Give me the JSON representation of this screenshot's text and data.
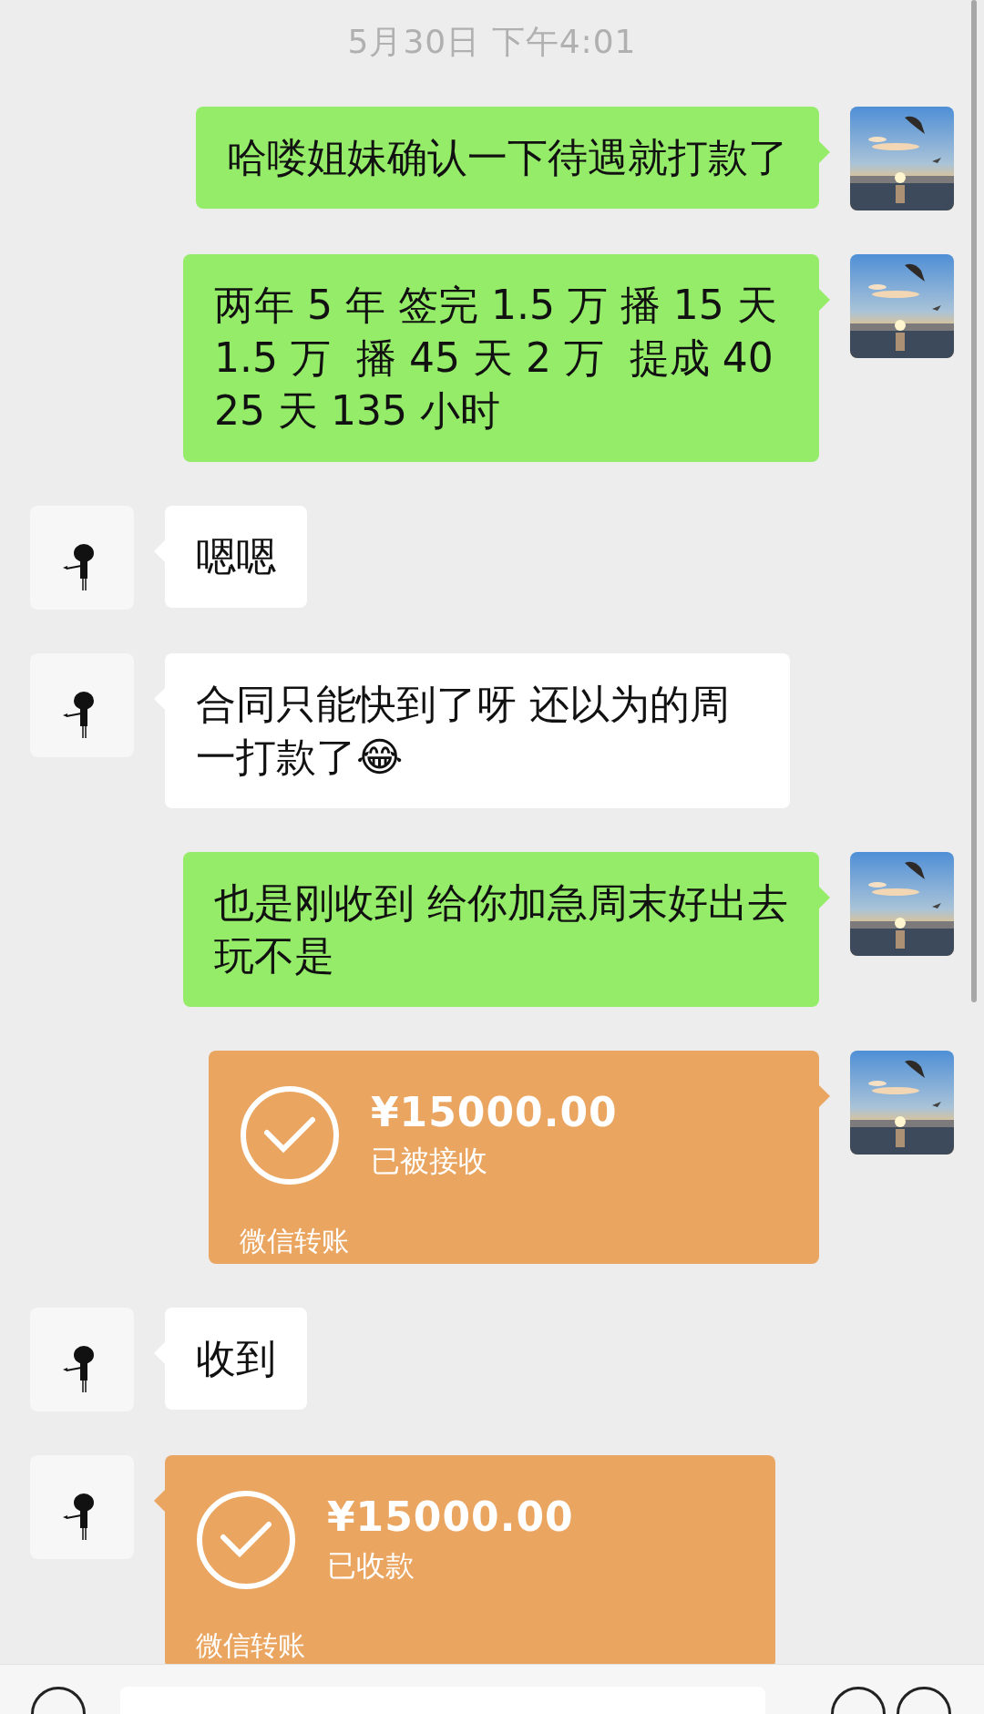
{
  "timestamp": "5月30日 下午4:01",
  "messages": [
    {
      "kind": "text",
      "outgoing": true,
      "text": "哈喽姐妹确认一下待遇就打款了"
    },
    {
      "kind": "text",
      "outgoing": true,
      "text": "两年 5 年 签完 1.5 万 播 15 天 1.5 万  播 45 天 2 万  提成 40 25 天 135 小时"
    },
    {
      "kind": "text",
      "outgoing": false,
      "text": "嗯嗯"
    },
    {
      "kind": "text",
      "outgoing": false,
      "text": "合同只能快到了呀 还以为的周一打款了😂"
    },
    {
      "kind": "text",
      "outgoing": true,
      "text": "也是刚收到 给你加急周末好出去玩不是"
    },
    {
      "kind": "transfer",
      "outgoing": true,
      "amount": "¥15000.00",
      "status": "已被接收",
      "footer": "微信转账"
    },
    {
      "kind": "text",
      "outgoing": false,
      "text": "收到"
    },
    {
      "kind": "transfer",
      "outgoing": false,
      "amount": "¥15000.00",
      "status": "已收款",
      "footer": "微信转账"
    }
  ]
}
